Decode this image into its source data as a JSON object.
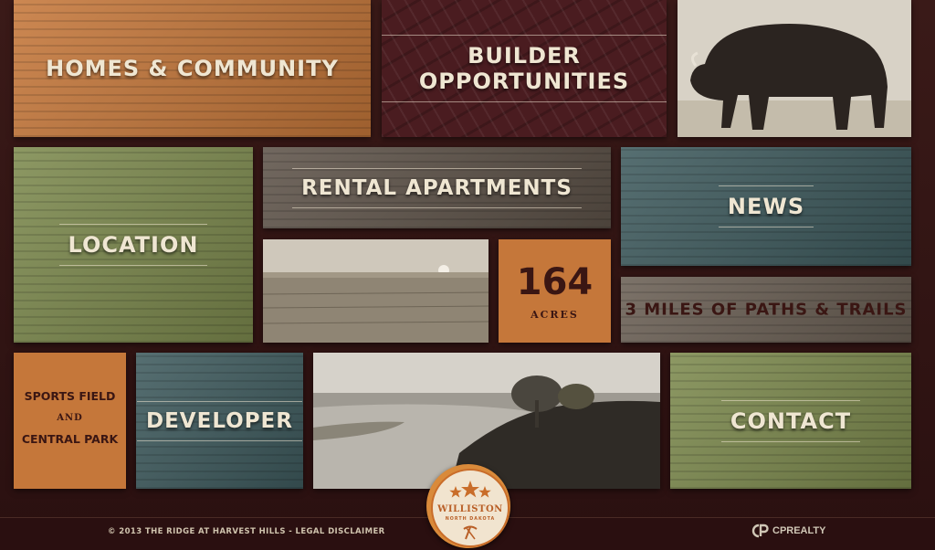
{
  "tiles": {
    "homes": {
      "label": "HOMES & COMMUNITY"
    },
    "builder": {
      "label": "BUILDER OPPORTUNITIES"
    },
    "location": {
      "label": "LOCATION"
    },
    "rental": {
      "label": "RENTAL APARTMENTS"
    },
    "news": {
      "label": "NEWS"
    },
    "acres": {
      "value": "164",
      "unit": "ACRES"
    },
    "paths": {
      "label": "3 MILES OF PATHS & TRAILS"
    },
    "sports": {
      "line1": "SPORTS FIELD",
      "line2": "AND",
      "line3": "CENTRAL PARK"
    },
    "developer": {
      "label": "DEVELOPER"
    },
    "contact": {
      "label": "CONTACT"
    }
  },
  "seal": {
    "name": "WILLISTON",
    "sub": "NORTH DAKOTA"
  },
  "footer": {
    "copyright": "© 2013 THE RIDGE AT HARVEST HILLS - LEGAL DISCLAIMER",
    "brand": "CPREALTY"
  },
  "colors": {
    "orange": "#c5773a",
    "maroon": "#4a1c20",
    "green": "#7d8a4e",
    "teal": "#3f5b5e",
    "taupe": "#5e5349",
    "accent": "#d98a3a"
  },
  "icons": [
    "bison-photo",
    "wheat-field-photo",
    "river-photo",
    "star-icon",
    "pickaxe-icon"
  ]
}
